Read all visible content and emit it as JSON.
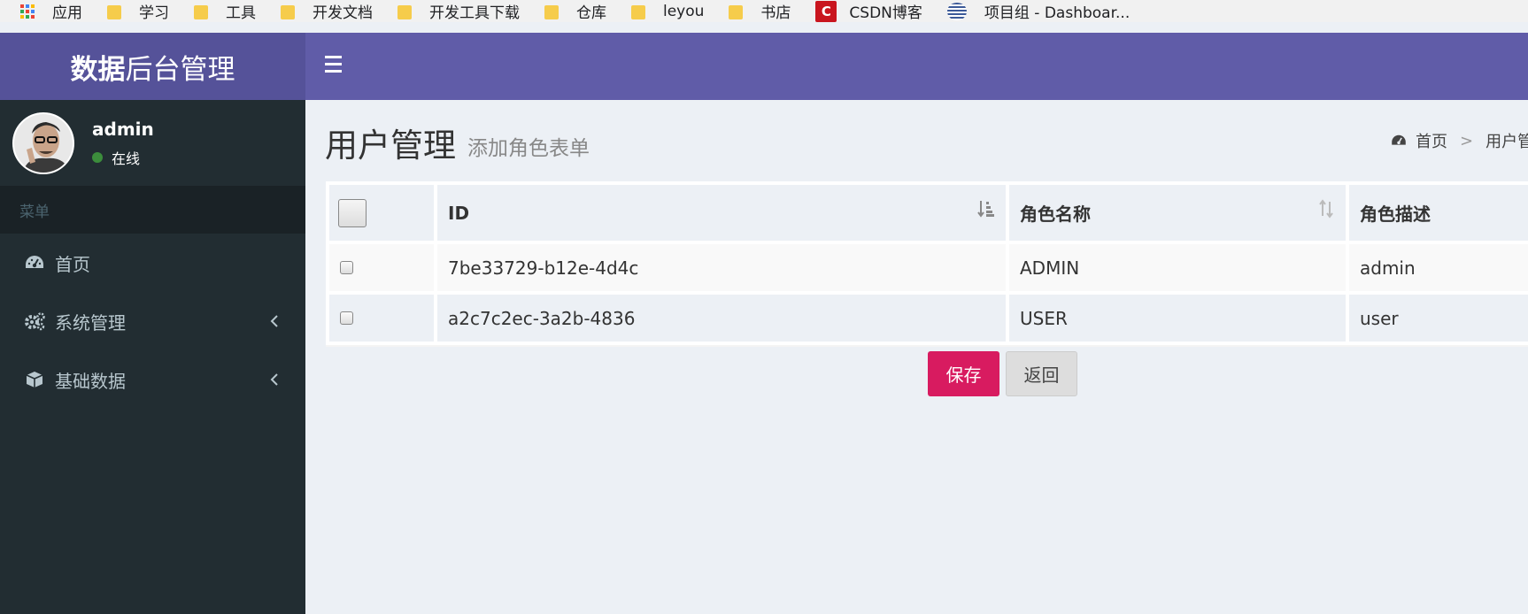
{
  "bookmarks": [
    {
      "label": "应用",
      "icon": "apps-icon"
    },
    {
      "label": "学习",
      "icon": "folder-icon"
    },
    {
      "label": "工具",
      "icon": "folder-icon"
    },
    {
      "label": "开发文档",
      "icon": "folder-icon"
    },
    {
      "label": "开发工具下载",
      "icon": "folder-icon"
    },
    {
      "label": "仓库",
      "icon": "folder-icon"
    },
    {
      "label": "leyou",
      "icon": "folder-icon"
    },
    {
      "label": "书店",
      "icon": "folder-icon"
    },
    {
      "label": "CSDN博客",
      "icon": "csdn-icon"
    },
    {
      "label": "项目组 - Dashboar...",
      "icon": "project-icon"
    }
  ],
  "header": {
    "logo_bold": "数据",
    "logo_rest": "后台管理",
    "accent": "#605ca8",
    "logo_bg": "#555299"
  },
  "sidebar": {
    "user": {
      "name": "admin",
      "status": "在线"
    },
    "menu_header": "菜单",
    "items": [
      {
        "label": "首页",
        "icon": "dashboard-icon"
      },
      {
        "label": "系统管理",
        "icon": "cogs-icon"
      },
      {
        "label": "基础数据",
        "icon": "cube-icon"
      }
    ]
  },
  "page": {
    "title": "用户管理",
    "subtitle": "添加角色表单",
    "breadcrumb": {
      "home": "首页",
      "current": "用户管理"
    }
  },
  "table": {
    "columns": [
      "ID",
      "角色名称",
      "角色描述"
    ],
    "rows": [
      {
        "id": "7be33729-b12e-4d4c",
        "name": "ADMIN",
        "desc": "admin"
      },
      {
        "id": "a2c7c2ec-3a2b-4836",
        "name": "USER",
        "desc": "user"
      }
    ]
  },
  "buttons": {
    "save": "保存",
    "back": "返回",
    "save_color": "#d81b60"
  }
}
